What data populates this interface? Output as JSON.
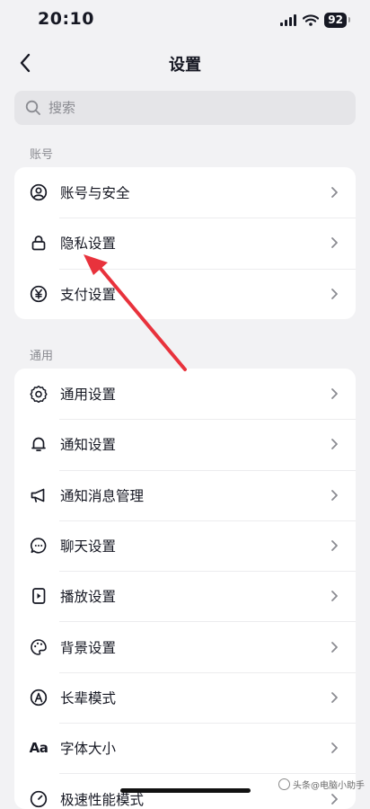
{
  "status_bar": {
    "time": "20:10",
    "battery": "92"
  },
  "nav": {
    "title": "设置",
    "back_icon": "chevron-left-icon"
  },
  "search": {
    "placeholder": "搜索",
    "icon": "search-icon"
  },
  "sections": [
    {
      "label": "账号",
      "items": [
        {
          "label": "账号与安全",
          "icon": "user-circle-icon"
        },
        {
          "label": "隐私设置",
          "icon": "lock-icon"
        },
        {
          "label": "支付设置",
          "icon": "yen-circle-icon"
        }
      ]
    },
    {
      "label": "通用",
      "items": [
        {
          "label": "通用设置",
          "icon": "gear-icon"
        },
        {
          "label": "通知设置",
          "icon": "bell-icon"
        },
        {
          "label": "通知消息管理",
          "icon": "megaphone-icon"
        },
        {
          "label": "聊天设置",
          "icon": "chat-bubble-icon"
        },
        {
          "label": "播放设置",
          "icon": "play-file-icon"
        },
        {
          "label": "背景设置",
          "icon": "palette-icon"
        },
        {
          "label": "长辈模式",
          "icon": "elder-mode-icon"
        },
        {
          "label": "字体大小",
          "icon": "font-size-icon",
          "glyph": "Aa"
        },
        {
          "label": "极速性能模式",
          "icon": "speed-icon"
        }
      ]
    }
  ],
  "annotation": {
    "color": "#e8323c",
    "description": "red-arrow-pointing-to-privacy-settings"
  },
  "watermark": {
    "text": "头条@电脑小助手"
  },
  "colors": {
    "background": "#f2f2f4",
    "card": "#ffffff",
    "text": "#161823",
    "secondary": "#8a8b91"
  }
}
